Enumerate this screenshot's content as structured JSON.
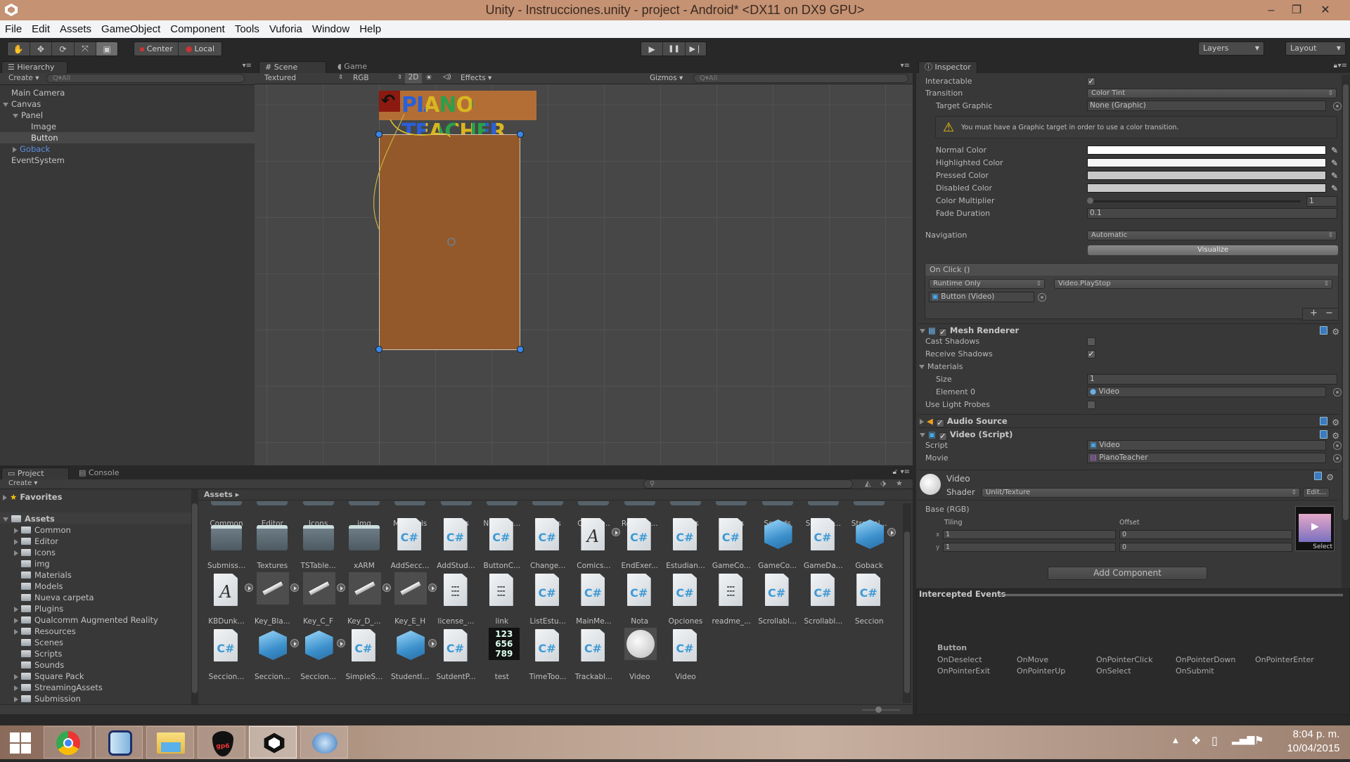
{
  "window": {
    "title": "Unity - Instrucciones.unity - project - Android* <DX11 on DX9 GPU>",
    "minimize": "–",
    "maximize": "❐",
    "close": "✕"
  },
  "menu": [
    "File",
    "Edit",
    "Assets",
    "GameObject",
    "Component",
    "Tools",
    "Vuforia",
    "Window",
    "Help"
  ],
  "toolbar": {
    "tools": [
      "hand-tool",
      "move-tool",
      "rotate-tool",
      "scale-tool",
      "rect-tool"
    ],
    "tool_glyphs": [
      "✋",
      "✥",
      "⟳",
      "⤧",
      "▣"
    ],
    "pivot": "Center",
    "space": "Local",
    "play": "▶",
    "pause": "❚❚",
    "step": "▶❘",
    "layers": "Layers",
    "layout": "Layout"
  },
  "hierarchy": {
    "tab": "Hierarchy",
    "create": "Create",
    "search_placeholder": "Q▾All",
    "items": [
      {
        "label": "Main Camera",
        "depth": 0,
        "expand": "none",
        "selected": false,
        "color": "#c3c3c3"
      },
      {
        "label": "Canvas",
        "depth": 0,
        "expand": "open",
        "selected": false,
        "color": "#c3c3c3"
      },
      {
        "label": "Panel",
        "depth": 1,
        "expand": "open",
        "selected": false,
        "color": "#c3c3c3"
      },
      {
        "label": "Image",
        "depth": 2,
        "expand": "none",
        "selected": false,
        "color": "#c3c3c3"
      },
      {
        "label": "Button",
        "depth": 2,
        "expand": "none",
        "selected": true,
        "color": "#e0e0e0"
      },
      {
        "label": "Goback",
        "depth": 1,
        "expand": "closed",
        "selected": false,
        "color": "#5b8fe0"
      },
      {
        "label": "EventSystem",
        "depth": 0,
        "expand": "none",
        "selected": false,
        "color": "#c3c3c3"
      }
    ]
  },
  "scene": {
    "tabs": [
      "Scene",
      "Game"
    ],
    "shading": "Textured",
    "render_mode": "RGB",
    "mode_2d": "2D",
    "effects": "Effects",
    "gizmos": "Gizmos",
    "search_placeholder": "Q▾All",
    "banner_text": "PIANO TEACHER",
    "panel_color": "#94592a"
  },
  "inspector": {
    "tab": "Inspector",
    "interactable_label": "Interactable",
    "interactable": true,
    "transition_label": "Transition",
    "transition": "Color Tint",
    "target_graphic_label": "Target Graphic",
    "target_graphic": "None (Graphic)",
    "warning": "You must have a Graphic target in order to use a color transition.",
    "colors": [
      {
        "label": "Normal Color",
        "value": "#ffffff"
      },
      {
        "label": "Highlighted Color",
        "value": "#f5f5f5"
      },
      {
        "label": "Pressed Color",
        "value": "#c8c8c8"
      },
      {
        "label": "Disabled Color",
        "value": "#c8c8c8"
      }
    ],
    "color_multiplier_label": "Color Multiplier",
    "color_multiplier": "1",
    "fade_duration_label": "Fade Duration",
    "fade_duration": "0.1",
    "navigation_label": "Navigation",
    "navigation": "Automatic",
    "visualize": "Visualize",
    "onclick": {
      "header": "On Click ()",
      "runtime": "Runtime Only",
      "function": "Video.PlayStop",
      "target": "Button (Video)",
      "add": "+",
      "remove": "−"
    },
    "mesh_renderer": {
      "title": "Mesh Renderer",
      "enabled": true,
      "cast_shadows_label": "Cast Shadows",
      "cast_shadows": false,
      "receive_shadows_label": "Receive Shadows",
      "receive_shadows": true,
      "materials_label": "Materials",
      "size_label": "Size",
      "size": "1",
      "element0_label": "Element 0",
      "element0": "Video",
      "light_probes_label": "Use Light Probes",
      "light_probes": false
    },
    "audio_source": {
      "title": "Audio Source",
      "enabled": true
    },
    "video_script": {
      "title": "Video (Script)",
      "enabled": true,
      "script_label": "Script",
      "script": "Video",
      "movie_label": "Movie",
      "movie": "PianoTeacher"
    },
    "material": {
      "name": "Video",
      "shader_label": "Shader",
      "shader": "Unlit/Texture",
      "edit": "Edit...",
      "base_label": "Base (RGB)",
      "tiling_label": "Tiling",
      "offset_label": "Offset",
      "tiling_x": "1",
      "tiling_y": "1",
      "offset_x": "0",
      "offset_y": "0",
      "select": "Select"
    },
    "add_component": "Add Component"
  },
  "intercepted": {
    "header": "Intercepted Events",
    "object": "Button",
    "events": [
      "OnDeselect",
      "OnMove",
      "OnPointerClick",
      "OnPointerDown",
      "OnPointerEnter",
      "OnPointerExit",
      "OnPointerUp",
      "OnSelect",
      "OnSubmit"
    ]
  },
  "project": {
    "tabs": [
      "Project",
      "Console"
    ],
    "create": "Create",
    "favorites": "Favorites",
    "assets_root": "Assets",
    "breadcrumb": "Assets ▸",
    "tree": [
      {
        "label": "Common",
        "expand": true
      },
      {
        "label": "Editor",
        "expand": true
      },
      {
        "label": "Icons",
        "expand": true
      },
      {
        "label": "img",
        "expand": false
      },
      {
        "label": "Materials",
        "expand": false
      },
      {
        "label": "Models",
        "expand": false
      },
      {
        "label": "Nueva carpeta",
        "expand": false
      },
      {
        "label": "Plugins",
        "expand": true
      },
      {
        "label": "Qualcomm Augmented Reality",
        "expand": true
      },
      {
        "label": "Resources",
        "expand": true
      },
      {
        "label": "Scenes",
        "expand": false
      },
      {
        "label": "Scripts",
        "expand": false
      },
      {
        "label": "Sounds",
        "expand": false
      },
      {
        "label": "Square Pack",
        "expand": true
      },
      {
        "label": "StreamingAssets",
        "expand": true
      },
      {
        "label": "Submission",
        "expand": true
      }
    ],
    "grid": [
      [
        {
          "label": "Common",
          "type": "folder-top"
        },
        {
          "label": "Editor",
          "type": "folder-top"
        },
        {
          "label": "Icons",
          "type": "folder-top"
        },
        {
          "label": "img",
          "type": "folder-top"
        },
        {
          "label": "Materials",
          "type": "folder-top"
        },
        {
          "label": "Models",
          "type": "folder-top"
        },
        {
          "label": "Nueva c...",
          "type": "folder-top"
        },
        {
          "label": "Plugins",
          "type": "folder-top"
        },
        {
          "label": "Qualco...",
          "type": "folder-top"
        },
        {
          "label": "Resourc...",
          "type": "folder-top"
        },
        {
          "label": "Scenes",
          "type": "folder-top"
        },
        {
          "label": "Scripts",
          "type": "folder-top"
        },
        {
          "label": "Sounds",
          "type": "folder-top"
        },
        {
          "label": "Square ...",
          "type": "folder-top"
        },
        {
          "label": "Streami...",
          "type": "folder-top"
        }
      ],
      [
        {
          "label": "Submiss...",
          "type": "folder"
        },
        {
          "label": "Textures",
          "type": "folder"
        },
        {
          "label": "TSTable...",
          "type": "folder"
        },
        {
          "label": "xARM",
          "type": "folder"
        },
        {
          "label": "AddSecc...",
          "type": "cs"
        },
        {
          "label": "AddStud...",
          "type": "cs"
        },
        {
          "label": "ButtonC...",
          "type": "cs"
        },
        {
          "label": "Change...",
          "type": "cs"
        },
        {
          "label": "Comics...",
          "type": "font",
          "play": true
        },
        {
          "label": "EndExer...",
          "type": "cs"
        },
        {
          "label": "Estudian...",
          "type": "cs"
        },
        {
          "label": "GameCo...",
          "type": "cs"
        },
        {
          "label": "GameCo...",
          "type": "cube"
        },
        {
          "label": "GameDa...",
          "type": "cs"
        },
        {
          "label": "Goback",
          "type": "cube",
          "play": true
        }
      ],
      [
        {
          "label": "KBDunk...",
          "type": "font",
          "play": true
        },
        {
          "label": "Key_Bla...",
          "type": "key",
          "play": true
        },
        {
          "label": "Key_C_F",
          "type": "key",
          "play": true
        },
        {
          "label": "Key_D_...",
          "type": "key",
          "play": true
        },
        {
          "label": "Key_E_H",
          "type": "key",
          "play": true
        },
        {
          "label": "license_...",
          "type": "txt"
        },
        {
          "label": "link",
          "type": "txt"
        },
        {
          "label": "ListEstu...",
          "type": "cs"
        },
        {
          "label": "MainMe...",
          "type": "cs"
        },
        {
          "label": "Nota",
          "type": "cs"
        },
        {
          "label": "Opciones",
          "type": "cs"
        },
        {
          "label": "readme_...",
          "type": "txt"
        },
        {
          "label": "Scrollabl...",
          "type": "cs"
        },
        {
          "label": "Scrollabl...",
          "type": "cs"
        },
        {
          "label": "Seccion",
          "type": "cs"
        }
      ],
      [
        {
          "label": "Seccion...",
          "type": "cs"
        },
        {
          "label": "Seccion...",
          "type": "cube",
          "play": true
        },
        {
          "label": "Seccion...",
          "type": "cube",
          "play": true
        },
        {
          "label": "SimpleS...",
          "type": "cs"
        },
        {
          "label": "StudentI...",
          "type": "cube",
          "play": true
        },
        {
          "label": "SutdentP...",
          "type": "cs"
        },
        {
          "label": "test",
          "type": "test"
        },
        {
          "label": "TimeToo...",
          "type": "cs"
        },
        {
          "label": "Trackabl...",
          "type": "cs"
        },
        {
          "label": "Video",
          "type": "sphere"
        },
        {
          "label": "Video",
          "type": "cs"
        }
      ]
    ]
  },
  "taskbar": {
    "apps": [
      "start",
      "chrome",
      "virtualbox",
      "file-explorer",
      "guitar-pro",
      "unity",
      "monodevelop"
    ],
    "time": "8:04 p. m.",
    "date": "10/04/2015"
  }
}
